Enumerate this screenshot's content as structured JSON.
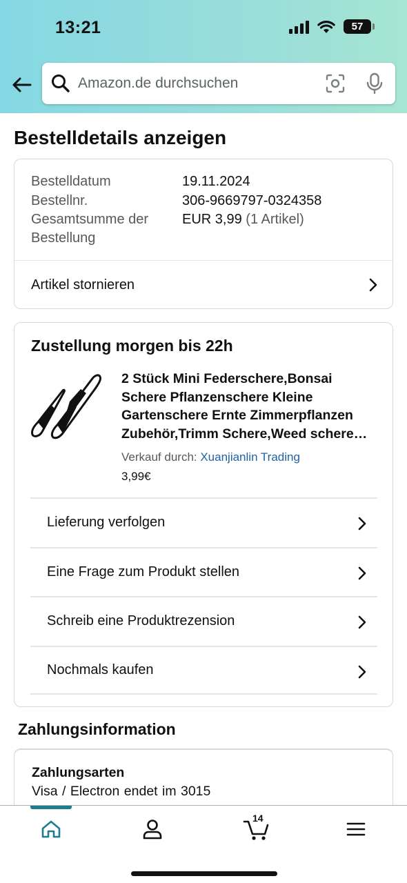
{
  "status_bar": {
    "time": "13:21",
    "battery": "57",
    "battery_level_percent": 57
  },
  "search": {
    "placeholder": "Amazon.de durchsuchen"
  },
  "page": {
    "title": "Bestelldetails anzeigen"
  },
  "order": {
    "date_label": "Bestelldatum",
    "date_value": "19.11.2024",
    "number_label": "Bestellnr.",
    "number_value": "306-9669797-0324358",
    "total_label_1": "Gesamtsumme der",
    "total_label_2": "Bestellung",
    "total_value": "EUR 3,99",
    "total_items": "(1 Artikel)",
    "cancel_label": "Artikel stornieren"
  },
  "delivery": {
    "title": "Zustellung morgen bis 22h",
    "product_title": "2 Stück Mini Federschere,Bonsai Schere Pflanzenschere Kleine Gartenschere Ernte Zimmerpflanzen Zubehör,Trimm Schere,Weed schere Gartenschere",
    "seller_prefix": "Verkauf durch: ",
    "seller_name": "Xuanjianlin Trading",
    "price": "3,99€",
    "actions": [
      {
        "label": "Lieferung verfolgen"
      },
      {
        "label": "Eine Frage zum Produkt stellen"
      },
      {
        "label": "Schreib eine Produktrezension"
      },
      {
        "label": "Nochmals kaufen"
      }
    ]
  },
  "payment": {
    "section_title": "Zahlungsinformation",
    "methods_label": "Zahlungsarten",
    "method_value": "Visa / Electron  endet im 3015"
  },
  "tabbar": {
    "cart_count": "14"
  },
  "colors": {
    "link": "#2162a1",
    "accent": "#1b7d8f",
    "header_gradient_start": "#84d8e3",
    "header_gradient_end": "#a6e5d2"
  },
  "icons": [
    "back-arrow-icon",
    "search-icon",
    "camera-scan-icon",
    "microphone-icon",
    "chevron-right-icon",
    "home-icon",
    "profile-icon",
    "cart-icon",
    "menu-icon"
  ]
}
